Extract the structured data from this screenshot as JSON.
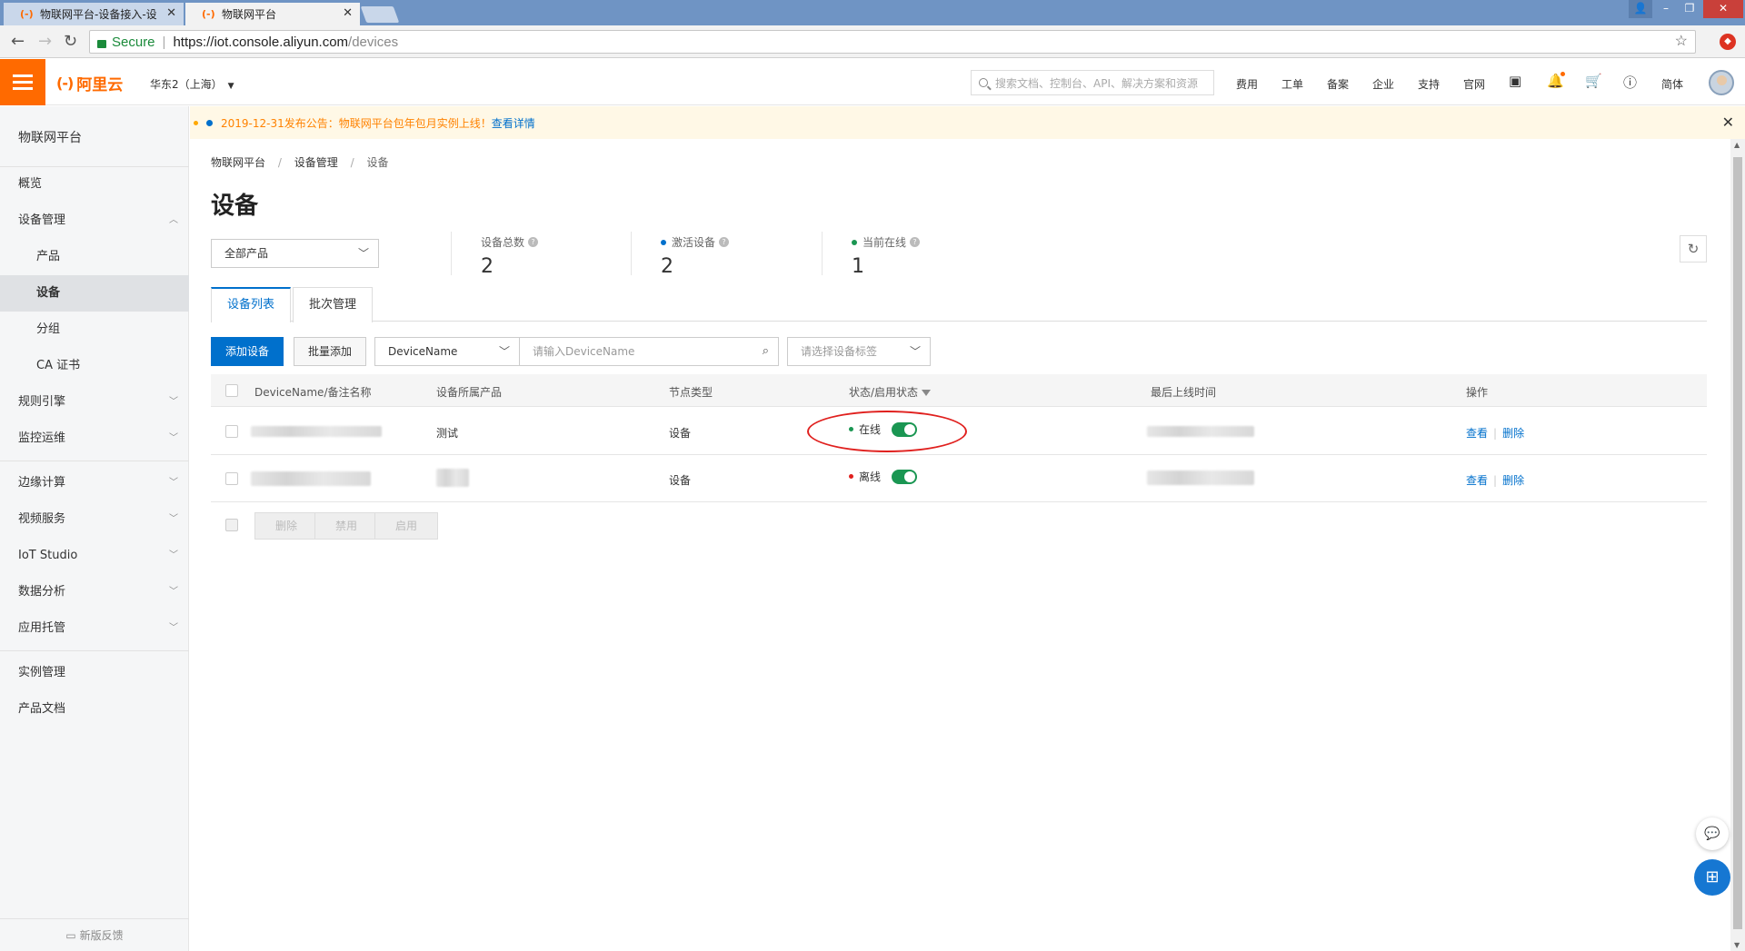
{
  "browser": {
    "tabs": [
      {
        "title": "物联网平台-设备接入-设",
        "active": false
      },
      {
        "title": "物联网平台",
        "active": true
      }
    ],
    "address": {
      "secure_label": "Secure",
      "scheme": "https://",
      "host": "iot.console.aliyun.com",
      "path": "/devices"
    }
  },
  "topbar": {
    "logo_text": "阿里云",
    "logo_mark": "(-)",
    "region": "华东2（上海）",
    "search_placeholder": "搜索文档、控制台、API、解决方案和资源",
    "nav": [
      "费用",
      "工单",
      "备案",
      "企业",
      "支持",
      "官网"
    ],
    "lang": "简体"
  },
  "sidebar": {
    "title": "物联网平台",
    "items": [
      {
        "label": "概览"
      },
      {
        "label": "设备管理",
        "expanded": true
      },
      {
        "label": "产品",
        "sub": true
      },
      {
        "label": "设备",
        "sub": true,
        "active": true
      },
      {
        "label": "分组",
        "sub": true
      },
      {
        "label": "CA 证书",
        "sub": true
      },
      {
        "label": "规则引擎"
      },
      {
        "label": "监控运维"
      },
      {
        "label": "边缘计算"
      },
      {
        "label": "视频服务"
      },
      {
        "label": "IoT Studio"
      },
      {
        "label": "数据分析"
      },
      {
        "label": "应用托管"
      },
      {
        "label": "实例管理"
      },
      {
        "label": "产品文档"
      }
    ],
    "feedback": "新版反馈"
  },
  "notice": {
    "text": "2019-12-31发布公告：物联网平台包年包月实例上线！",
    "link": "查看详情"
  },
  "breadcrumb": [
    "物联网平台",
    "设备管理",
    "设备"
  ],
  "page_title": "设备",
  "product_select": "全部产品",
  "stats": [
    {
      "label": "设备总数",
      "value": "2",
      "dot": null
    },
    {
      "label": "激活设备",
      "value": "2",
      "dot": "#0070cc"
    },
    {
      "label": "当前在线",
      "value": "1",
      "dot": "#1a9652"
    }
  ],
  "tabs": [
    "设备列表",
    "批次管理"
  ],
  "toolbar": {
    "add": "添加设备",
    "batch_add": "批量添加",
    "filter_field": "DeviceName",
    "search_placeholder": "请输入DeviceName",
    "tag_placeholder": "请选择设备标签"
  },
  "table": {
    "headers": [
      "DeviceName/备注名称",
      "设备所属产品",
      "节点类型",
      "状态/启用状态",
      "最后上线时间",
      "操作"
    ],
    "rows": [
      {
        "product": "测试",
        "node_type": "设备",
        "status": "在线",
        "status_color": "#1a9652",
        "enabled": true,
        "view": "查看",
        "delete": "删除"
      },
      {
        "product": "",
        "node_type": "设备",
        "status": "离线",
        "status_color": "#e0201e",
        "enabled": true,
        "view": "查看",
        "delete": "删除"
      }
    ]
  },
  "bulk_actions": [
    "删除",
    "禁用",
    "启用"
  ],
  "colors": {
    "brand": "#ff6a00",
    "primary": "#0070cc",
    "annotation": "#e0201e"
  }
}
